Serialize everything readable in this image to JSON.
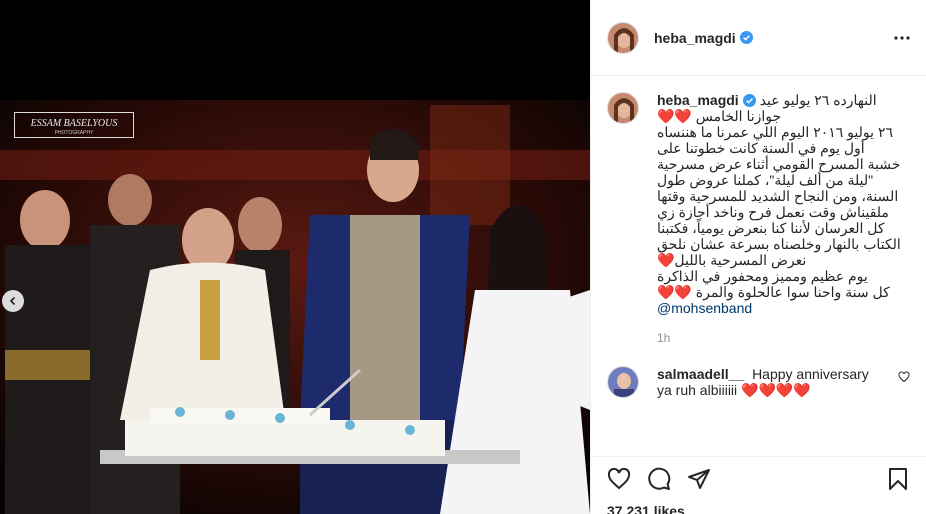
{
  "post": {
    "username": "heba_magdi",
    "verified": true,
    "watermark": "ESSAM BASELYOUS PHOTOGRAPHY"
  },
  "caption": {
    "lines": [
      "النهارده ٢٦ يوليو عيد",
      "جوازنا الخامس ❤️❤️",
      "٢٦ يوليو ٢٠١٦ اليوم اللي عمرنا ما هننساه",
      "أول يوم في السنة كانت خطوتنا على",
      "خشبة المسرح القومي أثناء عرض مسرحية",
      "\"ليلة من ألف ليلة\"، كملنا عروض طول",
      "السنة، ومن النجاح الشديد للمسرحية وقتها",
      "ملقيناش وقت نعمل فرح وناخد أجازة زي",
      "كل العرسان لأننا كنا بنعرض يومياً، فكتبنا",
      "الكتاب بالنهار وخلصناه بسرعة عشان نلحق",
      "نعرض المسرحية بالليل❤️",
      "يوم عظيم ومميز ومحفور في الذاكرة",
      "كل سنة واحنا سوا عالحلوة والمرة ❤️❤️"
    ],
    "mention": "@mohsenband",
    "time": "1h"
  },
  "reply": {
    "username": "salmaadell__",
    "text": "Happy anniversary ya ruh albiiiiii ❤️❤️❤️❤️"
  },
  "likes": "37,231 likes",
  "icons": {
    "like": "heart-outline-icon",
    "comment": "comment-bubble-icon",
    "share": "paper-plane-icon",
    "save": "bookmark-icon",
    "more": "three-dots-icon",
    "verified": "verified-badge-icon"
  },
  "colors": {
    "verified": "#3897f0",
    "heart": "#ed4956",
    "mention": "#00376b",
    "muted": "#8e8e8e"
  }
}
